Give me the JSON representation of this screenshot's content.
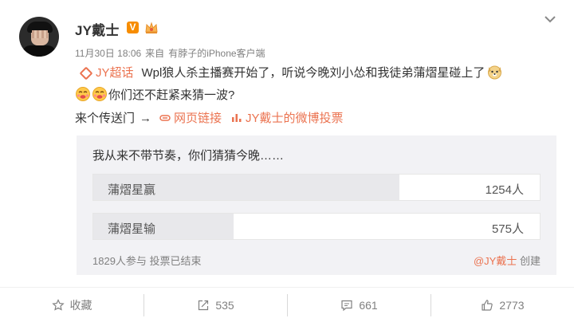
{
  "post": {
    "author": "JY戴士",
    "vbadge": "V",
    "time": "11月30日 18:06",
    "from_label": "来自",
    "client": "有脖子的iPhone客户端",
    "topic": "JY超话",
    "text_line1": "Wpl狼人杀主播赛开始了，听说今晚刘小怂和我徒弟蒲熠星碰上了",
    "text_line2": "你们还不赶紧来猜一波?",
    "portal": "来个传送门",
    "arrow": "→",
    "web_link": "网页链接",
    "vote_link": "JY戴士的微博投票"
  },
  "poll": {
    "title": "我从来不带节奏，你们猜猜今晚……",
    "options": [
      {
        "label": "蒲熠星赢",
        "count": "1254人",
        "fraction": 0.686
      },
      {
        "label": "蒲熠星输",
        "count": "575人",
        "fraction": 0.314
      }
    ],
    "summary": "1829人参与 投票已结束",
    "creator": "@JY戴士",
    "creator_suffix": "创建"
  },
  "actions": {
    "favorite": "收藏",
    "repost": "535",
    "comment": "661",
    "like": "2773"
  },
  "colors": {
    "accent": "#eb7350",
    "vbadge": "#f78d00",
    "poll_bg": "#f2f2f5"
  }
}
